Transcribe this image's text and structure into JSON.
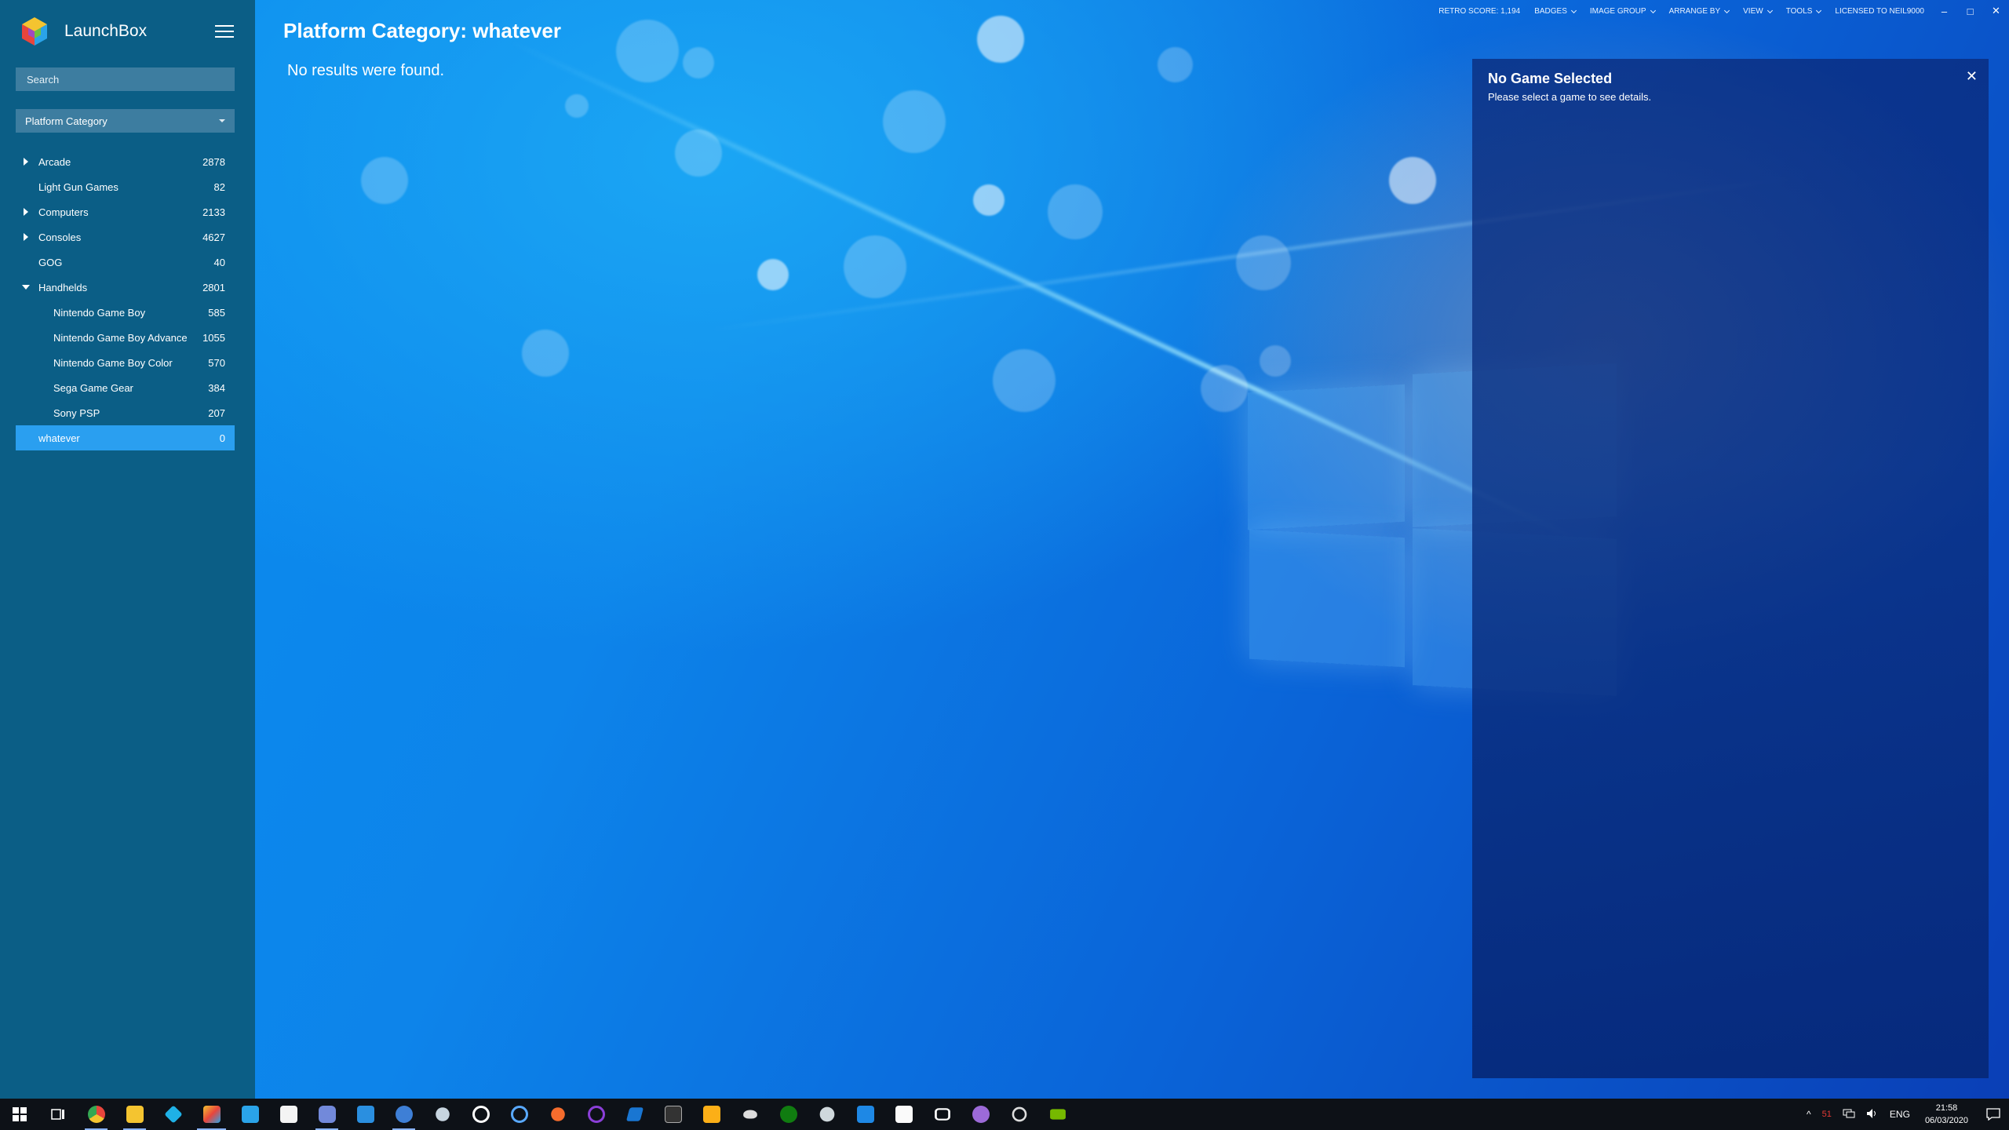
{
  "app": {
    "title": "LaunchBox"
  },
  "sidebar": {
    "search_placeholder": "Search",
    "filter_label": "Platform Category",
    "items": [
      {
        "label": "Arcade",
        "count": "2878",
        "expander": "collapsed"
      },
      {
        "label": "Light Gun Games",
        "count": "82",
        "expander": "none"
      },
      {
        "label": "Computers",
        "count": "2133",
        "expander": "collapsed"
      },
      {
        "label": "Consoles",
        "count": "4627",
        "expander": "collapsed"
      },
      {
        "label": "GOG",
        "count": "40",
        "expander": "none"
      },
      {
        "label": "Handhelds",
        "count": "2801",
        "expander": "expanded"
      },
      {
        "label": "Nintendo Game Boy",
        "count": "585",
        "child": true
      },
      {
        "label": "Nintendo Game Boy Advance",
        "count": "1055",
        "child": true
      },
      {
        "label": "Nintendo Game Boy Color",
        "count": "570",
        "child": true
      },
      {
        "label": "Sega Game Gear",
        "count": "384",
        "child": true
      },
      {
        "label": "Sony PSP",
        "count": "207",
        "child": true
      },
      {
        "label": "whatever",
        "count": "0",
        "selected": true
      }
    ]
  },
  "main": {
    "title": "Platform Category: whatever",
    "empty_message": "No results were found."
  },
  "topmenu": {
    "retro_score": "RETRO SCORE: 1,194",
    "badges": "BADGES",
    "image_group": "IMAGE GROUP",
    "arrange_by": "ARRANGE BY",
    "view": "VIEW",
    "tools": "TOOLS",
    "licensed": "LICENSED TO NEIL9000"
  },
  "window_controls": {
    "minimize": "–",
    "maximize": "□",
    "close": "✕"
  },
  "details": {
    "title": "No Game Selected",
    "subtitle": "Please select a game to see details.",
    "close": "✕"
  },
  "taskbar": {
    "apps": [
      "start-icon",
      "task-view-icon",
      "chrome-icon",
      "file-explorer-icon",
      "kodi-icon",
      "launchbox-icon",
      "cube-app-icon",
      "store-icon",
      "discord-icon",
      "mail-icon",
      "qbittorrent-icon",
      "steam-icon",
      "xbox-icon",
      "uplay-icon",
      "origin-icon",
      "circle-app-icon",
      "launcher-icon",
      "retroarch-icon",
      "rockstar-icon",
      "mask-icon",
      "xbox-green-icon",
      "globe-icon",
      "sky-icon",
      "fb-icon",
      "oculus-icon",
      "purple-app-icon",
      "power-icon",
      "nvidia-icon"
    ],
    "tray": {
      "hidden_icons": "^",
      "temp": "51",
      "language": "ENG",
      "time": "21:58",
      "date": "06/03/2020"
    },
    "colors": {
      "chrome": "#e8453c",
      "explorer": "#f4c430",
      "kodi": "#1fb1e6",
      "launchbox": "#f2a33a",
      "store": "#f4f4f4",
      "discord": "#7289da",
      "steam": "#c7d5e0",
      "nvidia": "#76b900"
    }
  },
  "colors": {
    "sidebar_bg": "#0b5e86",
    "selected_row": "#2a9ff0",
    "input_bg": "#3d7da0",
    "taskbar_bg": "#0d1117"
  }
}
